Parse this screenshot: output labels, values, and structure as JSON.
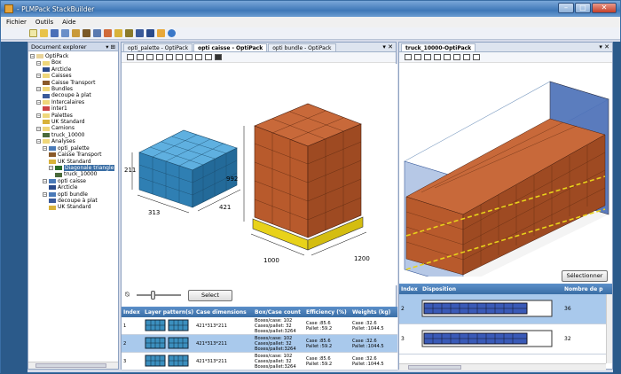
{
  "window": {
    "title": "- PLMPack StackBuilder"
  },
  "menu": [
    "Fichier",
    "Outils",
    "Aide"
  ],
  "explorer": {
    "title": "Document explorer",
    "tree": [
      {
        "label": "OptiPack",
        "level": 0,
        "type": "root"
      },
      {
        "label": "Box",
        "level": 1,
        "type": "folder"
      },
      {
        "label": "Arcticle",
        "level": 2,
        "type": "case"
      },
      {
        "label": "Caisses",
        "level": 1,
        "type": "folder"
      },
      {
        "label": "Caisse Transport",
        "level": 2,
        "type": "box"
      },
      {
        "label": "Bundles",
        "level": 1,
        "type": "folder"
      },
      {
        "label": "decoupe à plat",
        "level": 2,
        "type": "bundle"
      },
      {
        "label": "Intercalaires",
        "level": 1,
        "type": "folder"
      },
      {
        "label": "inter1",
        "level": 2,
        "type": "sheet"
      },
      {
        "label": "Palettes",
        "level": 1,
        "type": "folder"
      },
      {
        "label": "UK Standard",
        "level": 2,
        "type": "pallet"
      },
      {
        "label": "Camions",
        "level": 1,
        "type": "folder"
      },
      {
        "label": "truck_10000",
        "level": 2,
        "type": "truck"
      },
      {
        "label": "Analyses",
        "level": 1,
        "type": "folder"
      },
      {
        "label": "opti_palette",
        "level": 2,
        "type": "analysis"
      },
      {
        "label": "Caisse Transport",
        "level": 3,
        "type": "box"
      },
      {
        "label": "UK Standard",
        "level": 3,
        "type": "pallet"
      },
      {
        "label": "Diagonale triangle",
        "level": 3,
        "type": "solution",
        "selected": true
      },
      {
        "label": "truck_10000",
        "level": 4,
        "type": "truck"
      },
      {
        "label": "opti caisse",
        "level": 2,
        "type": "analysis"
      },
      {
        "label": "Arcticle",
        "level": 3,
        "type": "case"
      },
      {
        "label": "opti bundle",
        "level": 2,
        "type": "analysis"
      },
      {
        "label": "decoupe à plat",
        "level": 3,
        "type": "bundle"
      },
      {
        "label": "UK Standard",
        "level": 3,
        "type": "pallet"
      }
    ]
  },
  "doc_tabs": [
    {
      "label": "opti_palette - OptiPack",
      "active": false
    },
    {
      "label": "opti caisse - OptiPack",
      "active": true
    },
    {
      "label": "opti bundle - OptiPack",
      "active": false
    }
  ],
  "truck_tab": {
    "label": "truck_10000-OptiPack"
  },
  "case_view": {
    "dims": [
      "211",
      "313",
      "421"
    ]
  },
  "pallet_view": {
    "dims": [
      "992",
      "1000",
      "1200"
    ]
  },
  "select_button": "Select",
  "selectionner_button": "Sélectionner",
  "grid": {
    "headers": [
      "Index",
      "Layer pattern(s)",
      "Case dimensions",
      "Box/Case count",
      "Efficiency (%)",
      "Weights (kg) Case/Pallet"
    ],
    "rows": [
      {
        "index": "1",
        "dims": "421*313*211",
        "count": "Boxes/case: 102\nCases/pallet: 32\nBoxes/pallet:3264",
        "eff": "Case :85.6\nPallet :59.2",
        "w": "Case :32.6\nPallet :1044.5",
        "selected": false
      },
      {
        "index": "2",
        "dims": "421*313*211",
        "count": "Boxes/case: 102\nCases/pallet: 32\nBoxes/pallet:3264",
        "eff": "Case :85.6\nPallet :59.2",
        "w": "Case :32.6\nPallet :1044.5",
        "selected": true
      },
      {
        "index": "3",
        "dims": "421*313*211",
        "count": "Boxes/case: 102\nCases/pallet: 32\nBoxes/pallet:3264",
        "eff": "Case :85.6\nPallet :59.2",
        "w": "Case :32.6\nPallet :1044.5",
        "selected": false
      }
    ]
  },
  "truck_grid": {
    "headers": [
      "Index",
      "Disposition",
      "Nombre de p"
    ],
    "rows": [
      {
        "index": "2",
        "count": "36",
        "selected": true
      },
      {
        "index": "3",
        "count": "32",
        "selected": false
      }
    ]
  },
  "colors": {
    "accent": "#3a6ea5",
    "case_blue": "#3b8fbf",
    "box_orange": "#b85a2c",
    "pallet_yellow": "#e8d21a"
  }
}
